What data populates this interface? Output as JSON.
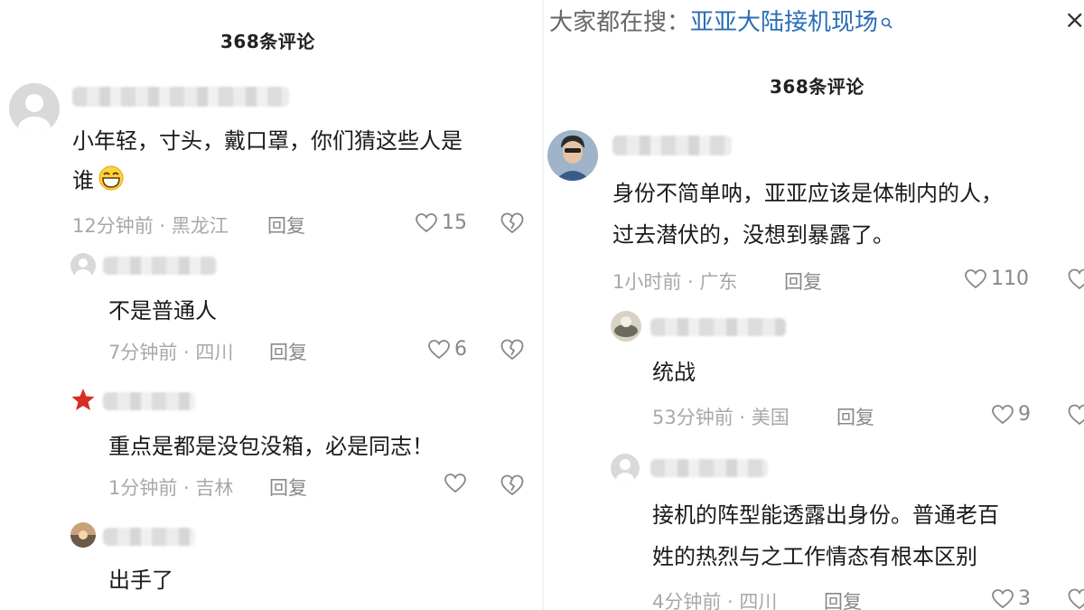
{
  "left_panel": {
    "title": "368条评论",
    "comment1": {
      "text_line1": "小年轻，寸头，戴口罩，你们猜这些人是",
      "text_line2": "谁",
      "emoji": "grinning-face-icon",
      "meta": "12分钟前 · 黑龙江",
      "reply": "回复",
      "likes": "15"
    },
    "reply1": {
      "text": "不是普通人",
      "meta": "7分钟前 · 四川",
      "reply": "回复",
      "likes": "6"
    },
    "reply2": {
      "text": "重点是都是没包没箱，必是同志！",
      "meta": "1分钟前 · 吉林",
      "reply": "回复",
      "likes": ""
    },
    "reply3": {
      "text": "出手了"
    }
  },
  "right_panel": {
    "search_prefix": "大家都在搜：",
    "search_term": "亚亚大陆接机现场",
    "close_label": "×",
    "title": "368条评论",
    "comment1": {
      "text_line1": "身份不简单呐，亚亚应该是体制内的人，",
      "text_line2": "过去潜伏的，没想到暴露了。",
      "meta": "1小时前 · 广东",
      "reply": "回复",
      "likes": "110"
    },
    "reply1": {
      "text": "统战",
      "meta": "53分钟前 · 美国",
      "reply": "回复",
      "likes": "9"
    },
    "reply2": {
      "text_line1": "接机的阵型能透露出身份。普通老百",
      "text_line2": "姓的热烈与之工作情态有根本区别",
      "meta": "4分钟前 · 四川",
      "reply": "回复",
      "likes": "3"
    }
  },
  "colors": {
    "accent_link": "#2a6eb5",
    "meta_gray": "#a8a8a8",
    "text": "#1a1a1a"
  }
}
